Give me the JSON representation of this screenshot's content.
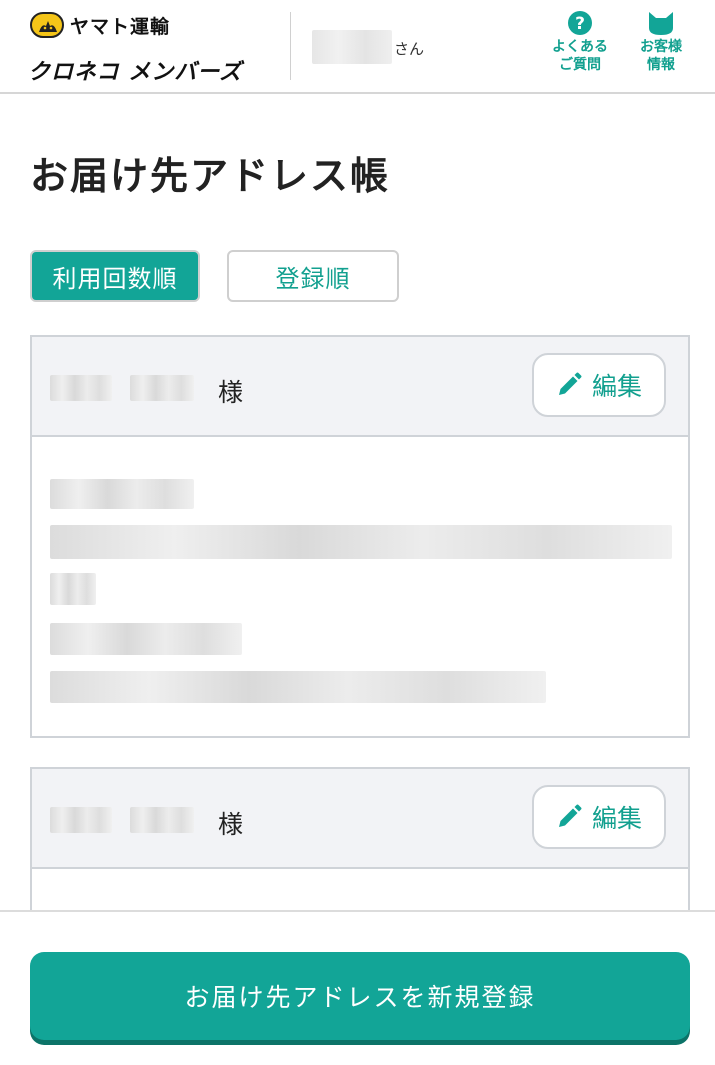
{
  "header": {
    "brand_name": "ヤマト運輸",
    "members_logo": "クロネコ メンバーズ",
    "user_suffix": "さん",
    "faq_label": "よくある\nご質問",
    "account_label": "お客様\n情報"
  },
  "page_title": "お届け先アドレス帳",
  "sort": {
    "by_usage": "利用回数順",
    "by_registration": "登録順"
  },
  "cards": [
    {
      "honorific": "様",
      "edit_label": "編集"
    },
    {
      "honorific": "様",
      "edit_label": "編集"
    }
  ],
  "footer": {
    "register_label": "お届け先アドレスを新規登録"
  },
  "colors": {
    "accent": "#12a597",
    "accent_text": "#12a08f",
    "card_header_bg": "#f2f3f6"
  },
  "icons": {
    "faq": "question-circle-icon",
    "account": "cat-head-icon",
    "edit": "pencil-icon",
    "brand": "black-cat-logo-icon"
  }
}
